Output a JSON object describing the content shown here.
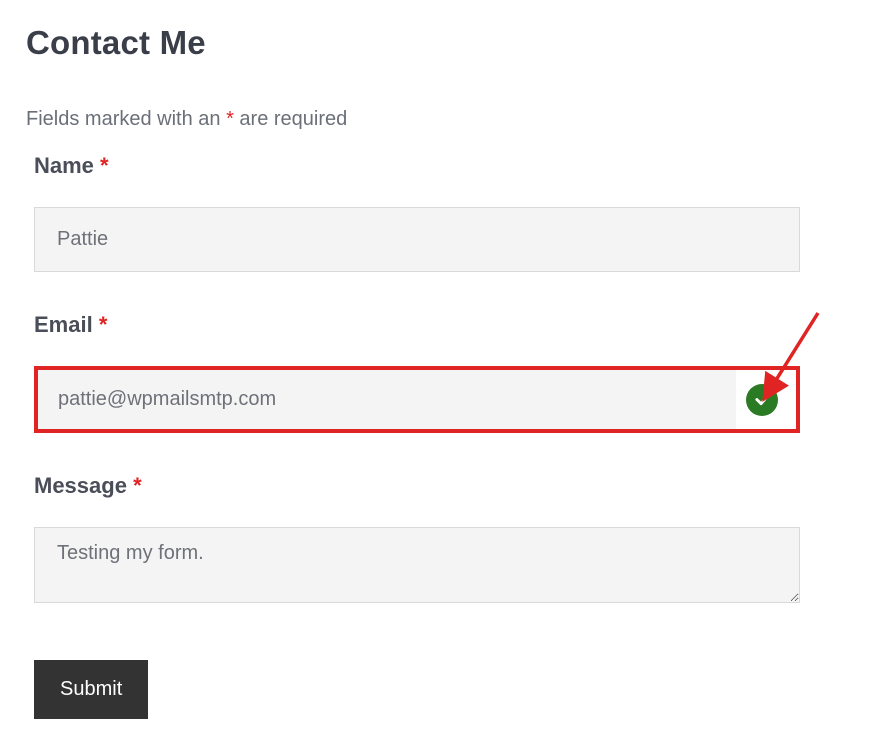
{
  "header": {
    "title": "Contact Me"
  },
  "required_note": {
    "prefix": "Fields marked with an ",
    "asterisk": "*",
    "suffix": " are required"
  },
  "fields": {
    "name": {
      "label": "Name",
      "asterisk": "*",
      "value": "Pattie"
    },
    "email": {
      "label": "Email",
      "asterisk": "*",
      "value": "pattie@wpmailsmtp.com"
    },
    "message": {
      "label": "Message",
      "asterisk": "*",
      "value": "Testing my form."
    }
  },
  "submit": {
    "label": "Submit"
  },
  "icons": {
    "check": "checkmark-icon",
    "arrow": "annotation-arrow"
  },
  "colors": {
    "highlight": "#e02424",
    "success": "#2b7b24",
    "submit_bg": "#333333",
    "input_bg": "#f4f4f4"
  }
}
